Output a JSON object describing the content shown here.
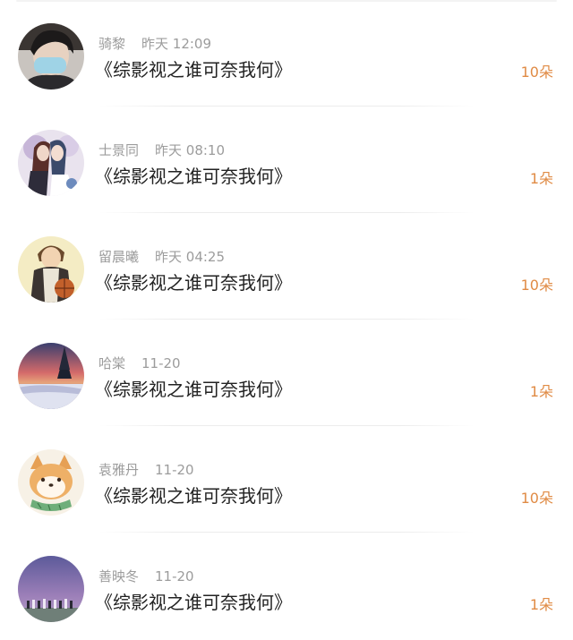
{
  "gifts": [
    {
      "name": "骑黎",
      "time": "昨天 12:09",
      "title": "《综影视之谁可奈我何》",
      "amount": "10朵",
      "avatar_icon": "masked-person-avatar"
    },
    {
      "name": "士景同",
      "time": "昨天 08:10",
      "title": "《综影视之谁可奈我何》",
      "amount": "1朵",
      "avatar_icon": "anime-couple-avatar"
    },
    {
      "name": "留晨曦",
      "time": "昨天 04:25",
      "title": "《综影视之谁可奈我何》",
      "amount": "10朵",
      "avatar_icon": "anime-basketball-boy-avatar"
    },
    {
      "name": "哈棠",
      "time": "11-20",
      "title": "《综影视之谁可奈我何》",
      "amount": "1朵",
      "avatar_icon": "snowy-sunset-avatar"
    },
    {
      "name": "袁雅丹",
      "time": "11-20",
      "title": "《综影视之谁可奈我何》",
      "amount": "10朵",
      "avatar_icon": "shiba-dog-avatar"
    },
    {
      "name": "善映冬",
      "time": "11-20",
      "title": "《综影视之谁可奈我何》",
      "amount": "1朵",
      "avatar_icon": "purple-sky-group-avatar"
    }
  ],
  "colors": {
    "amount": "#e08b45",
    "meta_text": "#9c9c9c",
    "title_text": "#222222"
  }
}
